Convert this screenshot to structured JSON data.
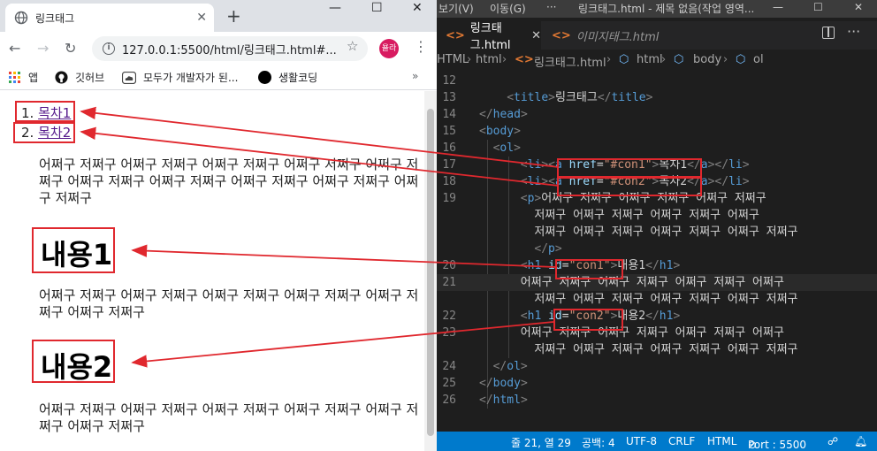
{
  "browser": {
    "tab_title": "링크태그",
    "tab_close": "✕",
    "new_tab": "+",
    "window_controls": {
      "minimize": "—",
      "maximize": "☐",
      "close": "✕"
    },
    "url": "127.0.0.1:5500/html/링크태그.html#...",
    "profile_label": "욜라",
    "bookmarks": [
      {
        "label": "앱",
        "icon": "apps-grid-icon"
      },
      {
        "label": "깃허브",
        "icon": "github-icon"
      },
      {
        "label": "모두가 개발자가 된...",
        "icon": "cloud-icon"
      },
      {
        "label": "생활코딩",
        "icon": "black-circle-icon"
      }
    ],
    "bookmarks_more": "»",
    "page": {
      "toc": [
        {
          "number": "1.",
          "link": "목차1"
        },
        {
          "number": "2.",
          "link": "목차2"
        }
      ],
      "paragraph1": "어쩌구 저쩌구 어쩌구 저쩌구 어쩌구 저쩌구 어쩌구 저쩌구 어쩌구 저쩌구 어쩌구 저쩌구 어쩌구 저쩌구 어쩌구 저쩌구 어쩌구 저쩌구 어쩌구 저쩌구",
      "heading1": "내용1",
      "paragraph2": "어쩌구 저쩌구 어쩌구 저쩌구 어쩌구 저쩌구 어쩌구 저쩌구 어쩌구 저쩌구 어쩌구 저쩌구",
      "heading2": "내용2",
      "paragraph3": "어쩌구 저쩌구 어쩌구 저쩌구 어쩌구 저쩌구 어쩌구 저쩌구 어쩌구 저쩌구 어쩌구 저쩌구"
    }
  },
  "vscode": {
    "menu": [
      "보기(V)",
      "이동(G)",
      "···"
    ],
    "window_title": "링크태그.html - 제목 없음(작업 영역...",
    "window_controls": {
      "minimize": "—",
      "maximize": "☐",
      "close": "✕"
    },
    "tabs": [
      {
        "label": "링크태그.html",
        "close": "✕",
        "icon": "<>"
      },
      {
        "label": "이미지태그.html",
        "icon": "<>"
      }
    ],
    "more": "···",
    "breadcrumbs": [
      "HTML",
      "html",
      "링크태그.html",
      "html",
      "body",
      "ol"
    ],
    "lines": [
      {
        "n": "12",
        "parts": []
      },
      {
        "n": "13",
        "parts": [
          [
            "br",
            "<"
          ],
          [
            "tag",
            "title"
          ],
          [
            "br",
            ">"
          ],
          [
            "txt",
            "링크태그"
          ],
          [
            "br",
            "</"
          ],
          [
            "tag",
            "title"
          ],
          [
            "br",
            ">"
          ]
        ]
      },
      {
        "n": "14",
        "parts": [
          [
            "br",
            "</"
          ],
          [
            "tag",
            "head"
          ],
          [
            "br",
            ">"
          ]
        ]
      },
      {
        "n": "15",
        "parts": [
          [
            "br",
            "<"
          ],
          [
            "tag",
            "body"
          ],
          [
            "br",
            ">"
          ]
        ]
      },
      {
        "n": "16",
        "parts": [
          [
            "br",
            "<"
          ],
          [
            "tag",
            "ol"
          ],
          [
            "br",
            ">"
          ]
        ]
      },
      {
        "n": "17",
        "parts": [
          [
            "br",
            "<"
          ],
          [
            "tag",
            "li"
          ],
          [
            "br",
            ">"
          ],
          [
            "br",
            "<"
          ],
          [
            "tag",
            "a"
          ],
          [
            "txt",
            " "
          ],
          [
            "attr",
            "href"
          ],
          [
            "txt",
            "="
          ],
          [
            "str",
            "\"#con1\""
          ],
          [
            "br",
            ">"
          ],
          [
            "txt",
            "목차1"
          ],
          [
            "br",
            "</"
          ],
          [
            "tag",
            "a"
          ],
          [
            "br",
            ">"
          ],
          [
            "br",
            "</"
          ],
          [
            "tag",
            "li"
          ],
          [
            "br",
            ">"
          ]
        ]
      },
      {
        "n": "18",
        "parts": [
          [
            "br",
            "<"
          ],
          [
            "tag",
            "li"
          ],
          [
            "br",
            ">"
          ],
          [
            "br",
            "<"
          ],
          [
            "tag",
            "a"
          ],
          [
            "txt",
            " "
          ],
          [
            "attr",
            "href"
          ],
          [
            "txt",
            "="
          ],
          [
            "str",
            "\"#con2\""
          ],
          [
            "br",
            ">"
          ],
          [
            "txt",
            "목차2"
          ],
          [
            "br",
            "</"
          ],
          [
            "tag",
            "a"
          ],
          [
            "br",
            ">"
          ],
          [
            "br",
            "</"
          ],
          [
            "tag",
            "li"
          ],
          [
            "br",
            ">"
          ]
        ]
      },
      {
        "n": "19",
        "parts": [
          [
            "br",
            "<"
          ],
          [
            "tag",
            "p"
          ],
          [
            "br",
            ">"
          ],
          [
            "txt",
            "어쩌구 저쩌구 어쩌구 저쩌구 어쩌구 저쩌구"
          ]
        ]
      },
      {
        "n": "",
        "parts": [
          [
            "txt",
            "저쩌구 어쩌구 저쩌구 어쩌구 저쩌구 어쩌구"
          ]
        ]
      },
      {
        "n": "",
        "parts": [
          [
            "txt",
            "저쩌구 어쩌구 저쩌구 어쩌구 저쩌구 어쩌구 저쩌구"
          ]
        ]
      },
      {
        "n": "",
        "parts": [
          [
            "br",
            "</"
          ],
          [
            "tag",
            "p"
          ],
          [
            "br",
            ">"
          ]
        ]
      },
      {
        "n": "20",
        "parts": [
          [
            "br",
            "<"
          ],
          [
            "tag",
            "h1"
          ],
          [
            "txt",
            " "
          ],
          [
            "attr",
            "id"
          ],
          [
            "txt",
            "="
          ],
          [
            "str",
            "\"con1\""
          ],
          [
            "br",
            ">"
          ],
          [
            "txt",
            "내용1"
          ],
          [
            "br",
            "</"
          ],
          [
            "tag",
            "h1"
          ],
          [
            "br",
            ">"
          ]
        ]
      },
      {
        "n": "21",
        "parts": [
          [
            "txt",
            "어쩌구 저쩌구 어쩌구 저쩌구 어쩌구 저쩌구 어쩌구"
          ]
        ]
      },
      {
        "n": "",
        "parts": [
          [
            "txt",
            "저쩌구 어쩌구 저쩌구 어쩌구 저쩌구 어쩌구 저쩌구"
          ]
        ]
      },
      {
        "n": "22",
        "parts": [
          [
            "br",
            "<"
          ],
          [
            "tag",
            "h1"
          ],
          [
            "txt",
            " "
          ],
          [
            "attr",
            "id"
          ],
          [
            "txt",
            "="
          ],
          [
            "str",
            "\"con2\""
          ],
          [
            "br",
            ">"
          ],
          [
            "txt",
            "내용2"
          ],
          [
            "br",
            "</"
          ],
          [
            "tag",
            "h1"
          ],
          [
            "br",
            ">"
          ]
        ]
      },
      {
        "n": "23",
        "parts": [
          [
            "txt",
            "어쩌구 저쩌구 어쩌구 저쩌구 어쩌구 저쩌구 어쩌구"
          ]
        ]
      },
      {
        "n": "",
        "parts": [
          [
            "txt",
            "저쩌구 어쩌구 저쩌구 어쩌구 저쩌구 어쩌구 저쩌구"
          ]
        ]
      },
      {
        "n": "24",
        "parts": [
          [
            "br",
            "</"
          ],
          [
            "tag",
            "ol"
          ],
          [
            "br",
            ">"
          ]
        ]
      },
      {
        "n": "25",
        "parts": [
          [
            "br",
            "</"
          ],
          [
            "tag",
            "body"
          ],
          [
            "br",
            ">"
          ]
        ]
      },
      {
        "n": "26",
        "parts": [
          [
            "br",
            "</"
          ],
          [
            "tag",
            "html"
          ],
          [
            "br",
            ">"
          ]
        ]
      }
    ],
    "status": {
      "position": "줄 21, 열 29",
      "spaces": "공백: 4",
      "encoding": "UTF-8",
      "eol": "CRLF",
      "language": "HTML",
      "port": "Port : 5500"
    }
  },
  "colors": {
    "annotation_red": "#e0282e",
    "vscode_status": "#007acc",
    "link_visited": "#551a8b"
  }
}
